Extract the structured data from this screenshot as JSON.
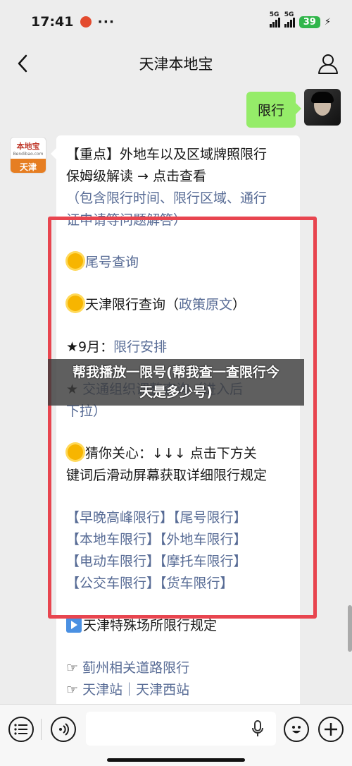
{
  "status_bar": {
    "time": "17:41",
    "more": "···",
    "signal_1": "5G",
    "signal_2": "5G",
    "battery": "39"
  },
  "navbar": {
    "title": "天津本地宝",
    "back_icon": "chevron-left-icon",
    "profile_icon": "user-icon"
  },
  "outgoing_message": {
    "text": "限行"
  },
  "bot_avatar": {
    "logo_text": "本地宝",
    "logo_sub": "Bendibao.com",
    "city": "天津"
  },
  "incoming_message": {
    "lines": [
      {
        "text": "【重点】外地车以及区域牌照限行",
        "link": false
      },
      {
        "text": "保姆级解读 → 点击查看",
        "link": false
      },
      {
        "text": "（包含限行时间、限行区域、通行",
        "link": true
      },
      {
        "text": "证申请等问题解答）",
        "link": true
      },
      {
        "text": "",
        "link": false
      },
      {
        "prefix_icon": "sun",
        "text": "尾号查询",
        "link": true
      },
      {
        "text": "",
        "link": false
      },
      {
        "prefix_icon": "sun",
        "text": "天津限行查询（",
        "link": false,
        "link_text": "政策原文",
        "suffix": "）"
      },
      {
        "text": "",
        "link": false
      },
      {
        "text": "★9月：",
        "link": false,
        "link_text": "限行安排",
        "suffix": ""
      },
      {
        "text": "",
        "link": false
      },
      {
        "text": "★ ",
        "link": false,
        "link_text": "交通组织调整查询",
        "suffix": "（进入后"
      },
      {
        "text": "下拉）",
        "link": true
      },
      {
        "text": "",
        "link": false
      },
      {
        "prefix_icon": "sun",
        "text": "猜你关心：↓↓↓ 点击下方关",
        "link": false
      },
      {
        "text": "键词后滑动屏幕获取详细限行规定",
        "link": false
      },
      {
        "text": "",
        "link": false
      },
      {
        "text": "【早晚高峰限行】【尾号限行】",
        "link": true
      },
      {
        "text": "【本地车限行】【外地车限行】",
        "link": true
      },
      {
        "text": "【电动车限行】【摩托车限行】",
        "link": true
      },
      {
        "text": "【公交车限行】【货车限行】",
        "link": true
      },
      {
        "text": "",
        "link": false
      },
      {
        "prefix_icon": "play",
        "text": "天津特殊场所限行规定",
        "link": false
      },
      {
        "text": "",
        "link": false
      },
      {
        "text": "☞ ",
        "link": false,
        "link_text": "蓟州相关道路限行",
        "suffix": ""
      },
      {
        "text": "☞ ",
        "link": false,
        "link_text": "天津站｜天津西站",
        "suffix": ""
      }
    ]
  },
  "video_overlay": {
    "line1": "帮我播放一限号(帮我查一查限行今",
    "line2": "天是多少号)"
  },
  "bottom_bar": {
    "voice_icon": "voice-icon",
    "keyboard_icon": "keyboard-icon",
    "mic_icon": "microphone-icon",
    "emoji_icon": "emoji-icon",
    "add_icon": "plus-icon"
  }
}
